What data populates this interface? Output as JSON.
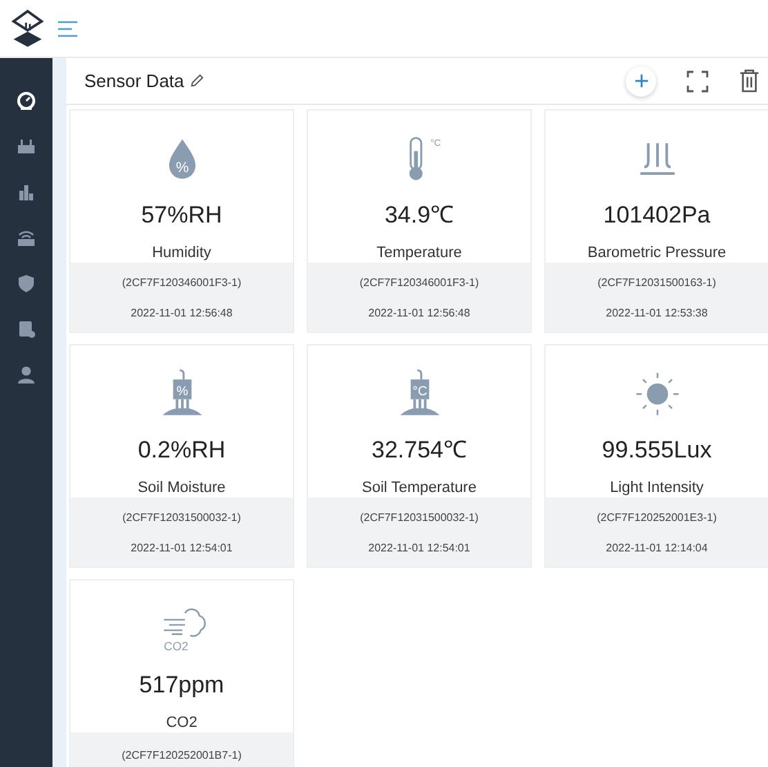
{
  "nav_items": [
    {
      "selected": true
    },
    {
      "selected": false
    },
    {
      "selected": false
    },
    {
      "selected": false
    },
    {
      "selected": false
    },
    {
      "selected": false
    },
    {
      "selected": false
    }
  ],
  "panel": {
    "title": "Sensor Data"
  },
  "cards": [
    {
      "icon_text": "%",
      "value": "57%RH",
      "label": "Humidity",
      "device": "(2CF7F120346001F3-1)",
      "time": "2022-11-01 12:56:48"
    },
    {
      "icon_text": "°C",
      "value": "34.9℃",
      "label": "Temperature",
      "device": "(2CF7F120346001F3-1)",
      "time": "2022-11-01 12:56:48"
    },
    {
      "value": "101402Pa",
      "label": "Barometric Pressure",
      "device": "(2CF7F12031500163-1)",
      "time": "2022-11-01 12:53:38"
    },
    {
      "icon_text": "%",
      "value": "0.2%RH",
      "label": "Soil Moisture",
      "device": "(2CF7F12031500032-1)",
      "time": "2022-11-01 12:54:01"
    },
    {
      "icon_text": "°C",
      "value": "32.754℃",
      "label": "Soil Temperature",
      "device": "(2CF7F12031500032-1)",
      "time": "2022-11-01 12:54:01"
    },
    {
      "value": "99.555Lux",
      "label": "Light Intensity",
      "device": "(2CF7F120252001E3-1)",
      "time": "2022-11-01 12:14:04"
    },
    {
      "icon_text": "CO2",
      "value": "517ppm",
      "label": "CO2",
      "device": "(2CF7F120252001B7-1)"
    }
  ]
}
